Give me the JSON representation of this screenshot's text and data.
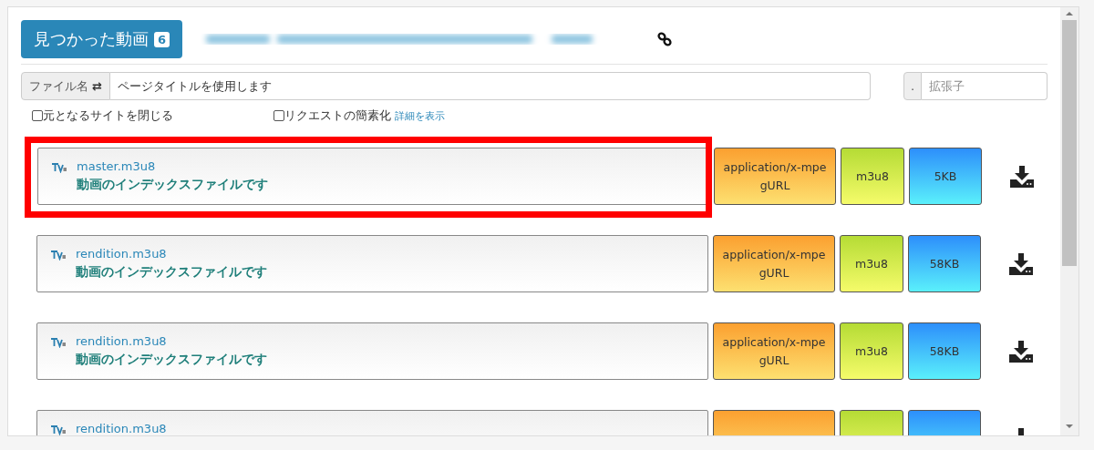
{
  "header": {
    "button": {
      "label": "見つかった動画",
      "count": "6"
    }
  },
  "filename": {
    "label": "ファイル名",
    "swap_icon": "⇄",
    "value": "ページタイトルを使用します"
  },
  "extension": {
    "addon": ".",
    "placeholder": "拡張子"
  },
  "options": [
    {
      "label": "元となるサイトを閉じる",
      "checked": false
    },
    {
      "label": "リクエストの簡素化",
      "checked": false,
      "link": "詳細を表示"
    }
  ],
  "items": [
    {
      "name": "master.m3u8",
      "description": "動画のインデックスファイルです",
      "mime": "application/x-mpegURL",
      "ext": "m3u8",
      "size": "5KB",
      "highlighted": true
    },
    {
      "name": "rendition.m3u8",
      "description": "動画のインデックスファイルです",
      "mime": "application/x-mpegURL",
      "ext": "m3u8",
      "size": "58KB",
      "highlighted": false
    },
    {
      "name": "rendition.m3u8",
      "description": "動画のインデックスファイルです",
      "mime": "application/x-mpegURL",
      "ext": "m3u8",
      "size": "58KB",
      "highlighted": false
    },
    {
      "name": "rendition.m3u8",
      "highlighted": false
    }
  ]
}
